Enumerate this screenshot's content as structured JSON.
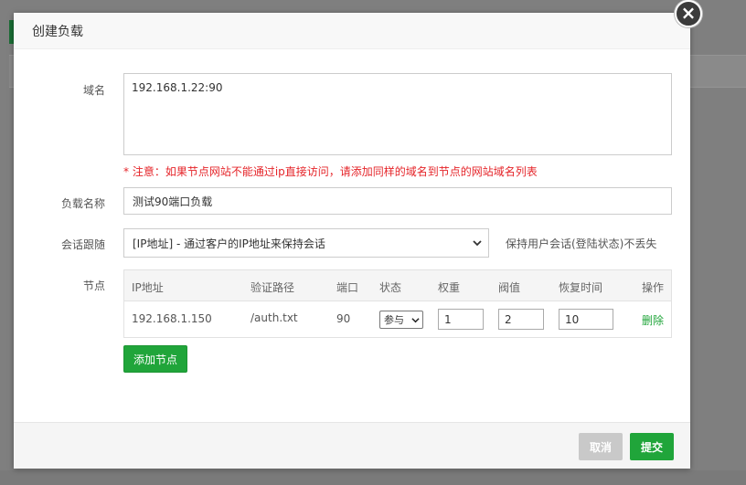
{
  "modal": {
    "title": "创建负载",
    "close_icon": "close-icon"
  },
  "form": {
    "domain_label": "域名",
    "domain_value": "192.168.1.22:90",
    "domain_note": "* 注意：如果节点网站不能通过ip直接访问，请添加同样的域名到节点的网站域名列表",
    "name_label": "负载名称",
    "name_value": "测试90端口负载",
    "session_label": "会话跟随",
    "session_selected": "[IP地址] - 通过客户的IP地址来保持会话",
    "session_hint": "保持用户会话(登陆状态)不丢失",
    "nodes_label": "节点"
  },
  "nodes_table": {
    "headers": [
      "IP地址",
      "验证路径",
      "端口",
      "状态",
      "权重",
      "阀值",
      "恢复时间",
      "操作"
    ],
    "rows": [
      {
        "ip": "192.168.1.150",
        "path": "/auth.txt",
        "port": "90",
        "status": "参与",
        "weight": "1",
        "threshold": "2",
        "recover_time": "10",
        "action": "删除"
      }
    ]
  },
  "buttons": {
    "add_node": "添加节点",
    "cancel": "取消",
    "submit": "提交"
  },
  "colors": {
    "accent": "#20a53a",
    "warning": "#e5252a",
    "cancel_bg": "#c9c9c9"
  }
}
